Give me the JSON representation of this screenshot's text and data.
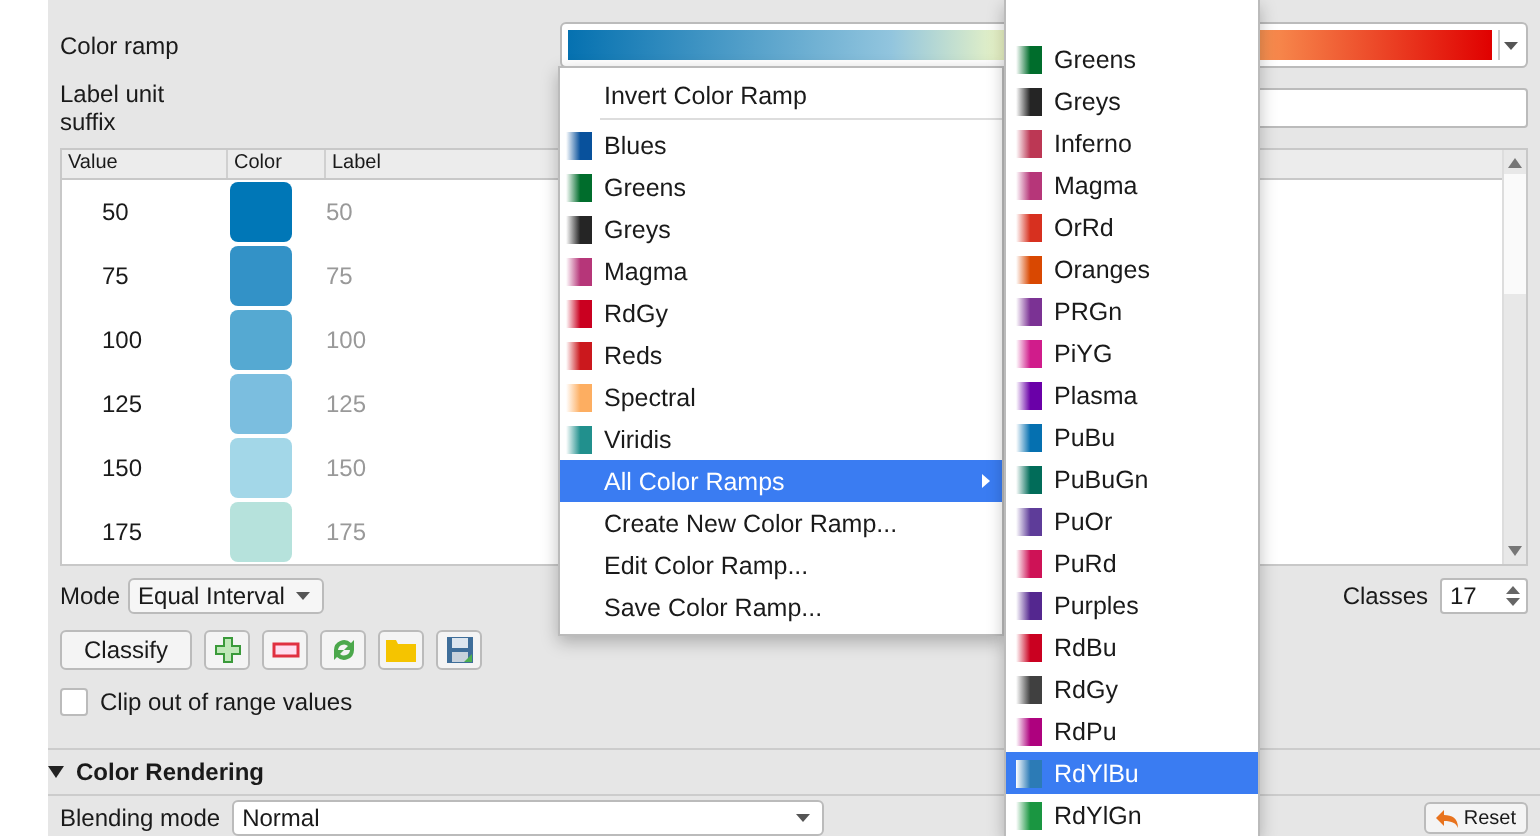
{
  "panel": {
    "color_ramp_label": "Color ramp",
    "label_unit_suffix_label": "Label unit suffix",
    "table": {
      "columns": [
        "Value",
        "Color",
        "Label"
      ],
      "rows": [
        {
          "value": "50",
          "color": "#0077b7",
          "label": "50"
        },
        {
          "value": "75",
          "color": "#3392c7",
          "label": "75"
        },
        {
          "value": "100",
          "color": "#55a9d2",
          "label": "100"
        },
        {
          "value": "125",
          "color": "#7bbedf",
          "label": "125"
        },
        {
          "value": "150",
          "color": "#a3d7e8",
          "label": "150"
        },
        {
          "value": "175",
          "color": "#b6e2dc",
          "label": "175"
        }
      ]
    },
    "mode": {
      "label": "Mode",
      "value": "Equal Interval"
    },
    "classes": {
      "label": "Classes",
      "value": "17"
    },
    "classify_button": "Classify",
    "clip_checkbox": {
      "label": "Clip out of range values",
      "checked": false
    },
    "color_rendering": {
      "title": "Color Rendering",
      "expanded": true
    },
    "blending_mode": {
      "label": "Blending mode",
      "value": "Normal"
    },
    "reset_button": "Reset"
  },
  "ramp_menu": {
    "items": [
      {
        "kind": "action",
        "label": "Invert Color Ramp",
        "selected": false
      },
      {
        "kind": "separator"
      },
      {
        "kind": "ramp",
        "label": "Blues",
        "color": "#08519c",
        "selected": false
      },
      {
        "kind": "ramp",
        "label": "Greens",
        "color": "#006d2c",
        "selected": false
      },
      {
        "kind": "ramp",
        "label": "Greys",
        "color": "#252525",
        "selected": false
      },
      {
        "kind": "ramp",
        "label": "Magma",
        "color": "#b63679",
        "selected": false
      },
      {
        "kind": "ramp",
        "label": "RdGy",
        "color": "#ca0020",
        "selected": false
      },
      {
        "kind": "ramp",
        "label": "Reds",
        "color": "#cb181d",
        "selected": false
      },
      {
        "kind": "ramp",
        "label": "Spectral",
        "color": "#fdae61",
        "selected": false
      },
      {
        "kind": "ramp",
        "label": "Viridis",
        "color": "#21908d",
        "selected": false
      },
      {
        "kind": "submenu",
        "label": "All Color Ramps",
        "selected": true
      },
      {
        "kind": "action",
        "label": "Create New Color Ramp...",
        "selected": false
      },
      {
        "kind": "action",
        "label": "Edit Color Ramp...",
        "selected": false
      },
      {
        "kind": "action",
        "label": "Save Color Ramp...",
        "selected": false
      }
    ]
  },
  "all_ramps_menu": {
    "items": [
      {
        "label": "Greens",
        "color": "#006d2c",
        "selected": false
      },
      {
        "label": "Greys",
        "color": "#252525",
        "selected": false
      },
      {
        "label": "Inferno",
        "color": "#bc3754",
        "selected": false
      },
      {
        "label": "Magma",
        "color": "#b63679",
        "selected": false
      },
      {
        "label": "OrRd",
        "color": "#d7301f",
        "selected": false
      },
      {
        "label": "Oranges",
        "color": "#d94801",
        "selected": false
      },
      {
        "label": "PRGn",
        "color": "#7b3294",
        "selected": false
      },
      {
        "label": "PiYG",
        "color": "#d01c8b",
        "selected": false
      },
      {
        "label": "Plasma",
        "color": "#6a00a8",
        "selected": false
      },
      {
        "label": "PuBu",
        "color": "#0570b0",
        "selected": false
      },
      {
        "label": "PuBuGn",
        "color": "#016c59",
        "selected": false
      },
      {
        "label": "PuOr",
        "color": "#5e3c99",
        "selected": false
      },
      {
        "label": "PuRd",
        "color": "#ce1256",
        "selected": false
      },
      {
        "label": "Purples",
        "color": "#54278f",
        "selected": false
      },
      {
        "label": "RdBu",
        "color": "#ca0020",
        "selected": false
      },
      {
        "label": "RdGy",
        "color": "#404040",
        "selected": false
      },
      {
        "label": "RdPu",
        "color": "#ae017e",
        "selected": false
      },
      {
        "label": "RdYlBu",
        "color": "#2c7bb6",
        "selected": true
      },
      {
        "label": "RdYlGn",
        "color": "#1a9641",
        "selected": false
      }
    ]
  }
}
